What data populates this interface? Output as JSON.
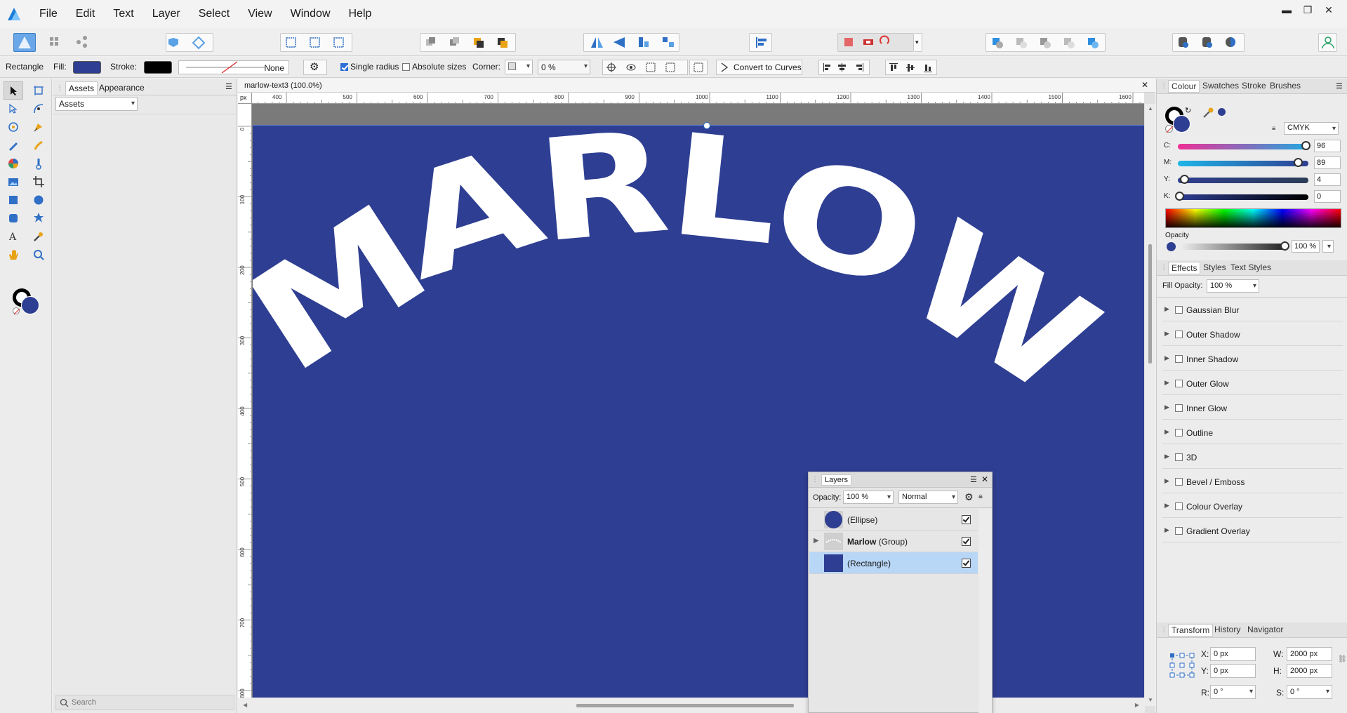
{
  "menubar": {
    "items": [
      "File",
      "Edit",
      "Text",
      "Layer",
      "Select",
      "View",
      "Window",
      "Help"
    ]
  },
  "context": {
    "tool_name": "Rectangle",
    "fill_label": "Fill:",
    "stroke_label": "Stroke:",
    "stroke_value": "None",
    "single_radius": "Single radius",
    "absolute_sizes": "Absolute sizes",
    "corner_label": "Corner:",
    "corner_value": "0 %",
    "convert_to_curves": "Convert to Curves",
    "fill_color": "#2e3e92",
    "stroke_color": "#000000"
  },
  "assets_panel": {
    "tabs": [
      "Assets",
      "Appearance"
    ],
    "dropdown": "Assets",
    "search_placeholder": "Search"
  },
  "document": {
    "tab_title": "marlow-text3 (100.0%)",
    "ruler_unit": "px",
    "ruler_top_ticks": [
      "400",
      "500",
      "600",
      "700",
      "800",
      "900",
      "1000",
      "1100",
      "1200",
      "1300",
      "1400",
      "1500",
      "1600"
    ],
    "ruler_left_ticks": [
      "0",
      "100",
      "200",
      "300",
      "400",
      "500",
      "600",
      "700",
      "800"
    ],
    "canvas_text": [
      "M",
      "A",
      "R",
      "L",
      "O",
      "W"
    ],
    "artboard_color": "#2e3e92"
  },
  "layers_panel": {
    "title": "Layers",
    "opacity_label": "Opacity:",
    "opacity_value": "100 %",
    "blend_mode": "Normal",
    "rows": [
      {
        "name": "(Ellipse)",
        "bold": "",
        "suffix": ""
      },
      {
        "name": "",
        "bold": "Marlow",
        "suffix": " (Group)"
      },
      {
        "name": "(Rectangle)",
        "bold": "",
        "suffix": ""
      }
    ]
  },
  "colour_panel": {
    "tabs": [
      "Colour",
      "Swatches",
      "Stroke",
      "Brushes"
    ],
    "model": "CMYK",
    "channels": [
      {
        "label": "C:",
        "value": "96"
      },
      {
        "label": "M:",
        "value": "89"
      },
      {
        "label": "Y:",
        "value": "4"
      },
      {
        "label": "K:",
        "value": "0"
      }
    ],
    "opacity_label": "Opacity",
    "opacity_value": "100 %"
  },
  "effects_panel": {
    "tabs": [
      "Effects",
      "Styles",
      "Text Styles"
    ],
    "fill_opacity_label": "Fill Opacity:",
    "fill_opacity_value": "100 %",
    "effects": [
      "Gaussian Blur",
      "Outer Shadow",
      "Inner Shadow",
      "Outer Glow",
      "Inner Glow",
      "Outline",
      "3D",
      "Bevel / Emboss",
      "Colour Overlay",
      "Gradient Overlay"
    ]
  },
  "transform_panel": {
    "tabs": [
      "Transform",
      "History",
      "Navigator"
    ],
    "x_label": "X:",
    "x_value": "0 px",
    "y_label": "Y:",
    "y_value": "0 px",
    "w_label": "W:",
    "w_value": "2000 px",
    "h_label": "H:",
    "h_value": "2000 px",
    "r_label": "R:",
    "r_value": "0 °",
    "s_label": "S:",
    "s_value": "0 °"
  }
}
